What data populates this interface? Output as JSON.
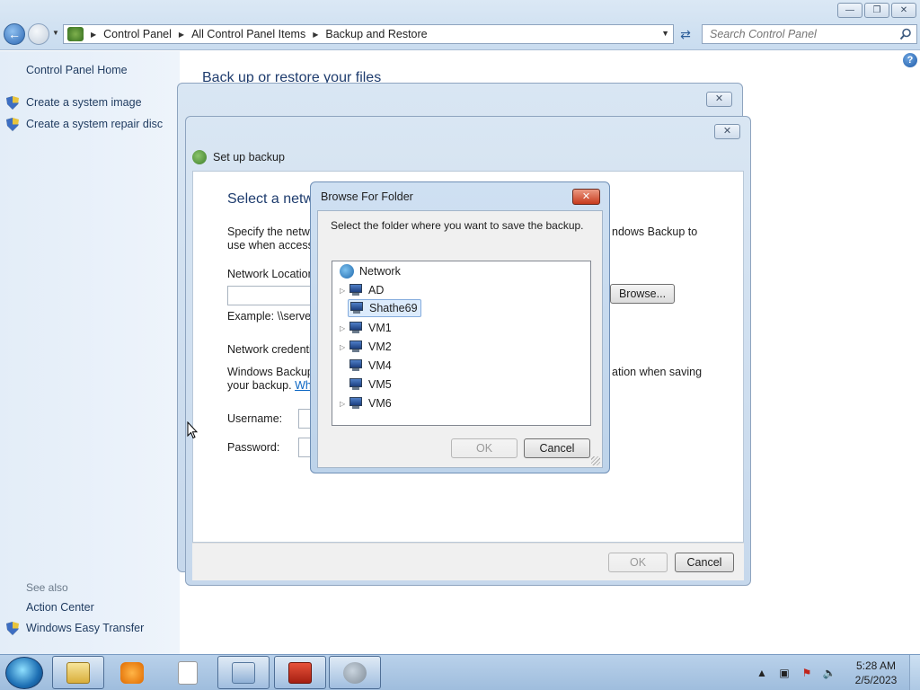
{
  "explorer": {
    "breadcrumbs": [
      "Control Panel",
      "All Control Panel Items",
      "Backup and Restore"
    ],
    "search_placeholder": "Search Control Panel",
    "main_title": "Back up or restore your files"
  },
  "left_pane": {
    "home_link": "Control Panel Home",
    "tasks": [
      "Create a system image",
      "Create a system repair disc"
    ],
    "see_also_label": "See also",
    "see_also": [
      "Action Center",
      "Windows Easy Transfer"
    ]
  },
  "setup_backup": {
    "title": "Set up backup",
    "heading": "Select a netwo",
    "specify_line1": "Specify the netwo",
    "specify_line1_right": "ndows Backup to",
    "specify_line2": "use when accessin",
    "network_location_label": "Network Location",
    "browse_button": "Browse...",
    "example": "Example: \\\\server\\",
    "credentials_label": "Network credentia",
    "cred_line1": "Windows Backup",
    "cred_line1_right": "ation when saving",
    "cred_line2": "your backup.",
    "cred_link": "Whi",
    "username_label": "Username:",
    "password_label": "Password:",
    "ok": "OK",
    "cancel": "Cancel"
  },
  "browse_dialog": {
    "title": "Browse For Folder",
    "prompt": "Select the folder where you want to save the backup.",
    "root": "Network",
    "items": [
      {
        "label": "AD",
        "expandable": true,
        "selected": false
      },
      {
        "label": "Shathe69",
        "expandable": false,
        "selected": true
      },
      {
        "label": "VM1",
        "expandable": true,
        "selected": false
      },
      {
        "label": "VM2",
        "expandable": true,
        "selected": false
      },
      {
        "label": "VM4",
        "expandable": false,
        "selected": false
      },
      {
        "label": "VM5",
        "expandable": false,
        "selected": false
      },
      {
        "label": "VM6",
        "expandable": true,
        "selected": false
      }
    ],
    "ok": "OK",
    "cancel": "Cancel"
  },
  "taskbar": {
    "time": "5:28 AM",
    "date": "2/5/2023",
    "pinned": [
      "explorer-icon",
      "media-player-icon",
      "notepad-icon",
      "control-panel-icon",
      "toolbox-icon",
      "backup-icon"
    ]
  }
}
